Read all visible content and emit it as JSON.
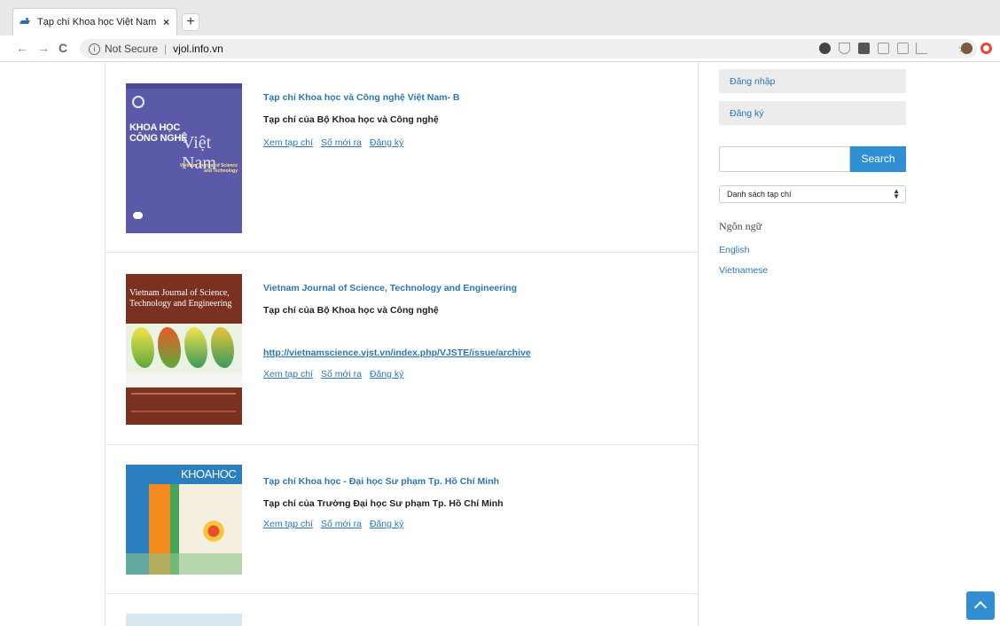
{
  "browser": {
    "tab_title": "Tạp chí Khoa học Việt Nam Tr",
    "tab_close": "×",
    "new_tab": "+",
    "back": "←",
    "forward": "→",
    "reload": "C",
    "security": "Not Secure",
    "url": "vjol.info.vn",
    "bookmark": "☆"
  },
  "journals": [
    {
      "title": "Tạp chí Khoa học và Công nghệ Việt Nam- B",
      "publisher": "Tạp chí của Bộ Khoa học và Công nghệ",
      "link": "",
      "actions": [
        "Xem tạp chí",
        "Số mới ra",
        "Đăng ký"
      ],
      "cover_text": [
        "KHOA HỌC",
        "CÔNG NGHỆ",
        "Việt Nam",
        "Vietnam Journal of Science and Technology"
      ]
    },
    {
      "title": "Vietnam Journal of Science, Technology and Engineering",
      "publisher": "Tạp chí của Bộ Khoa học và Công nghệ",
      "link": "http://vietnamscience.vjst.vn/index.php/VJSTE/issue/archive",
      "actions": [
        "Xem tạp chí",
        "Số mới ra",
        "Đăng ký"
      ],
      "cover_text": [
        "Vietnam Journal of Science,",
        "Technology and Engineering"
      ]
    },
    {
      "title": "Tạp chí Khoa học - Đại học Sư phạm Tp. Hồ Chí Minh",
      "publisher": "Tạp chí của Trường Đại học Sư phạm Tp. Hồ Chí Minh",
      "link": "",
      "actions": [
        "Xem tạp chí",
        "Số mới ra",
        "Đăng ký"
      ],
      "cover_text": [
        "KHOAHOC"
      ]
    }
  ],
  "sidebar": {
    "login": "Đăng nhập",
    "register": "Đăng ký",
    "search_button": "Search",
    "search_value": "",
    "journal_list_selected": "Danh sách tạp chí",
    "language_heading": "Ngôn ngữ",
    "languages": [
      "English",
      "Vietnamese"
    ]
  }
}
